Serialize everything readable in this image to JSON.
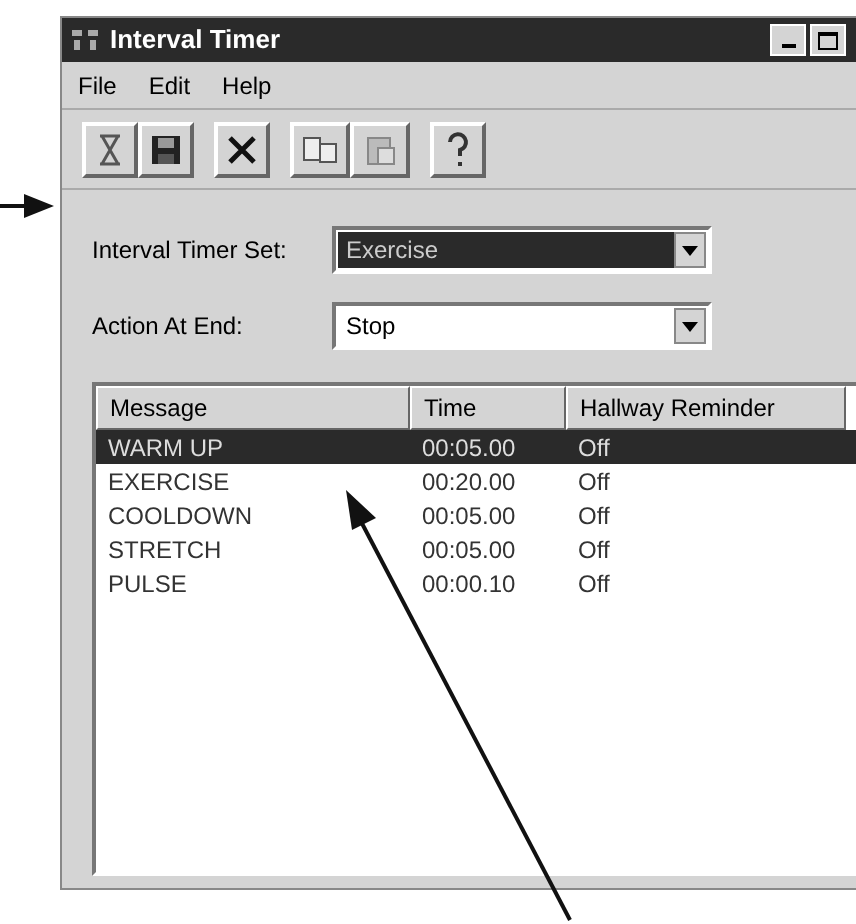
{
  "window": {
    "title": "Interval Timer"
  },
  "menu": [
    "File",
    "Edit",
    "Help"
  ],
  "fields": [
    {
      "label": "Interval Timer Set:",
      "value": "Exercise",
      "focused": true
    },
    {
      "label": "Action At End:",
      "value": "Stop",
      "focused": false
    }
  ],
  "table": {
    "columns": [
      "Message",
      "Time",
      "Hallway Reminder"
    ],
    "rows": [
      {
        "cells": [
          "WARM UP",
          "00:05.00",
          "Off"
        ],
        "selected": true
      },
      {
        "cells": [
          "EXERCISE",
          "00:20.00",
          "Off"
        ],
        "selected": false
      },
      {
        "cells": [
          "COOLDOWN",
          "00:05.00",
          "Off"
        ],
        "selected": false
      },
      {
        "cells": [
          "STRETCH",
          "00:05.00",
          "Off"
        ],
        "selected": false
      },
      {
        "cells": [
          "PULSE",
          "00:00.10",
          "Off"
        ],
        "selected": false
      }
    ]
  }
}
